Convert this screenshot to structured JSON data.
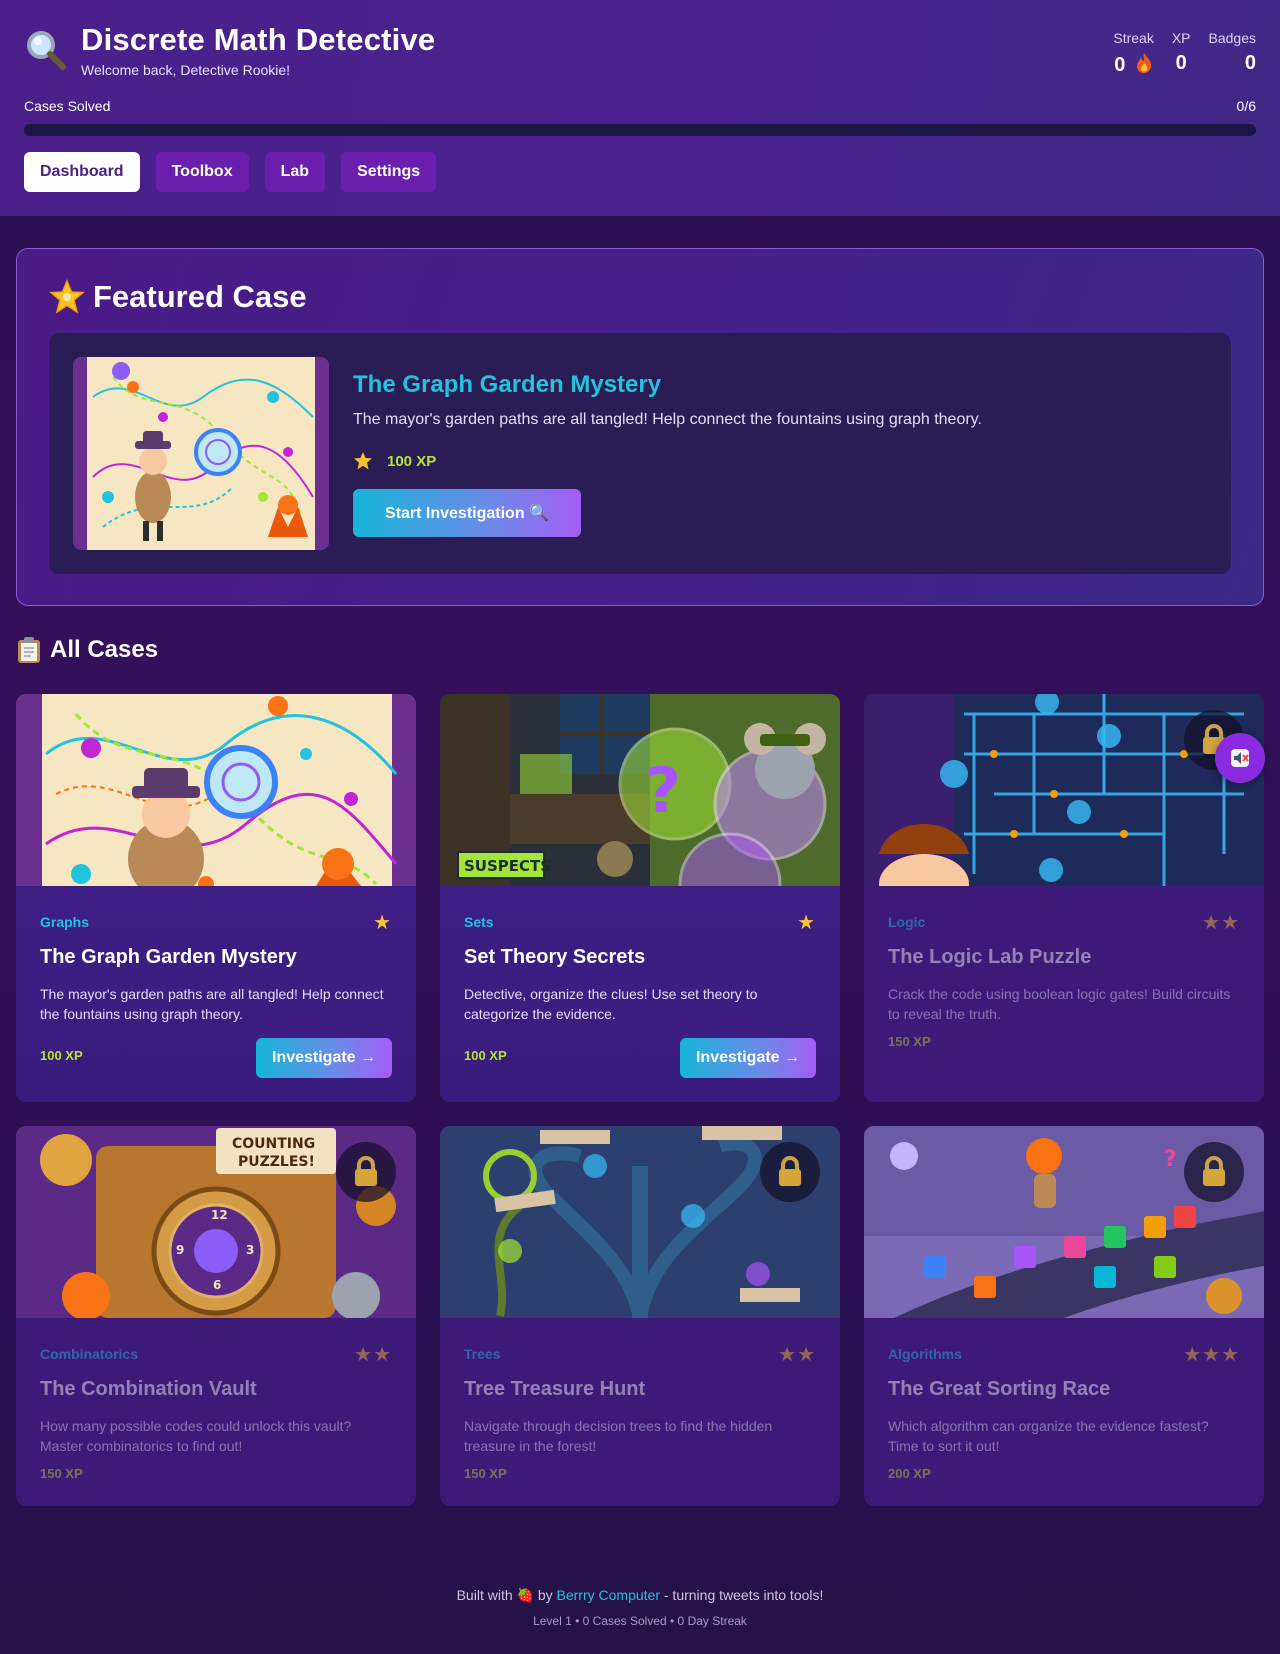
{
  "header": {
    "title": "Discrete Math Detective",
    "welcome": "Welcome back, Detective Rookie!",
    "icon": "magnifier-icon",
    "stats": [
      {
        "label": "Streak",
        "value": "0",
        "icon": "fire-icon"
      },
      {
        "label": "XP",
        "value": "0"
      },
      {
        "label": "Badges",
        "value": "0"
      }
    ],
    "progress": {
      "label": "Cases Solved",
      "count": "0/6",
      "fraction": 0
    }
  },
  "nav": {
    "items": [
      {
        "label": "Dashboard",
        "active": true
      },
      {
        "label": "Toolbox",
        "active": false
      },
      {
        "label": "Lab",
        "active": false
      },
      {
        "label": "Settings",
        "active": false
      }
    ]
  },
  "featured": {
    "heading": "Featured Case",
    "heading_icon": "glowing-star-icon",
    "title": "The Graph Garden Mystery",
    "description": "The mayor's garden paths are all tangled! Help connect the fountains using graph theory.",
    "xp": "100 XP",
    "button": "Start Investigation 🔍"
  },
  "cases": {
    "heading": "All Cases",
    "heading_icon": "clipboard-icon",
    "items": [
      {
        "category": "Graphs",
        "stars": "★",
        "title": "The Graph Garden Mystery",
        "description": "The mayor's garden paths are all tangled! Help connect the fountains using graph theory.",
        "xp": "100 XP",
        "button": "Investigate →",
        "locked": false
      },
      {
        "category": "Sets",
        "stars": "★",
        "title": "Set Theory Secrets",
        "description": "Detective, organize the clues! Use set theory to categorize the evidence.",
        "xp": "100 XP",
        "button": "Investigate →",
        "locked": false
      },
      {
        "category": "Logic",
        "stars": "★★",
        "title": "The Logic Lab Puzzle",
        "description": "Crack the code using boolean logic gates! Build circuits to reveal the truth.",
        "xp": "150 XP",
        "locked": true
      },
      {
        "category": "Combinatorics",
        "stars": "★★",
        "title": "The Combination Vault",
        "description": "How many possible codes could unlock this vault? Master combinatorics to find out!",
        "xp": "150 XP",
        "locked": true
      },
      {
        "category": "Trees",
        "stars": "★★",
        "title": "Tree Treasure Hunt",
        "description": "Navigate through decision trees to find the hidden treasure in the forest!",
        "xp": "150 XP",
        "locked": true
      },
      {
        "category": "Algorithms",
        "stars": "★★★",
        "title": "The Great Sorting Race",
        "description": "Which algorithm can organize the evidence fastest? Time to sort it out!",
        "xp": "200 XP",
        "locked": true
      }
    ]
  },
  "sound_button": {
    "icon": "muted-speaker-icon"
  },
  "footer": {
    "built_prefix": "Built with 🍓 by ",
    "link": "Berrry Computer",
    "built_suffix": " - turning tweets into tools!",
    "status": "Level 1 • 0 Cases Solved • 0 Day Streak"
  },
  "colors": {
    "accent_cyan": "#22c3de",
    "accent_purple": "#a45cf6",
    "xp_green": "#b5e62f",
    "star_gold": "#f7c52b"
  }
}
